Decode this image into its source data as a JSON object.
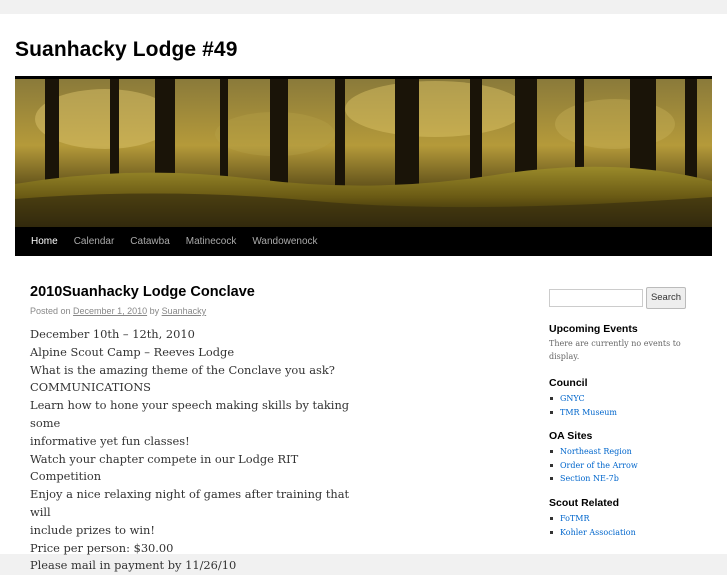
{
  "site": {
    "title": "Suanhacky Lodge #49"
  },
  "nav": {
    "items": [
      {
        "label": "Home",
        "current": true
      },
      {
        "label": "Calendar"
      },
      {
        "label": "Catawba"
      },
      {
        "label": "Matinecock"
      },
      {
        "label": "Wandowenock"
      }
    ]
  },
  "post": {
    "title": "2010Suanhacky Lodge Conclave",
    "meta": {
      "prefix": "Posted on",
      "date": "December 1, 2010",
      "by": "by",
      "author": "Suanhacky"
    },
    "lines": [
      "December 10th – 12th, 2010",
      "Alpine Scout Camp – Reeves Lodge",
      "What is the amazing theme of the Conclave you ask?",
      "COMMUNICATIONS",
      "Learn how to hone your speech making skills by taking some",
      "informative yet fun classes!",
      "Watch your chapter compete in our Lodge RIT Competition",
      "Enjoy a nice relaxing night of games after training that will",
      "include prizes to win!",
      "Price per person: $30.00",
      "Please mail in payment by 11/26/10"
    ]
  },
  "sidebar": {
    "search": {
      "placeholder": "",
      "button": "Search"
    },
    "events": {
      "title": "Upcoming Events",
      "text": "There are currently no events to display."
    },
    "council": {
      "title": "Council",
      "links": [
        "GNYC",
        "TMR Museum"
      ]
    },
    "oa_sites": {
      "title": "OA Sites",
      "links": [
        "Northeast Region",
        "Order of the Arrow",
        "Section NE-7b"
      ]
    },
    "scout_related": {
      "title": "Scout Related",
      "links": [
        "FoTMR",
        "Kohler Association"
      ]
    }
  }
}
